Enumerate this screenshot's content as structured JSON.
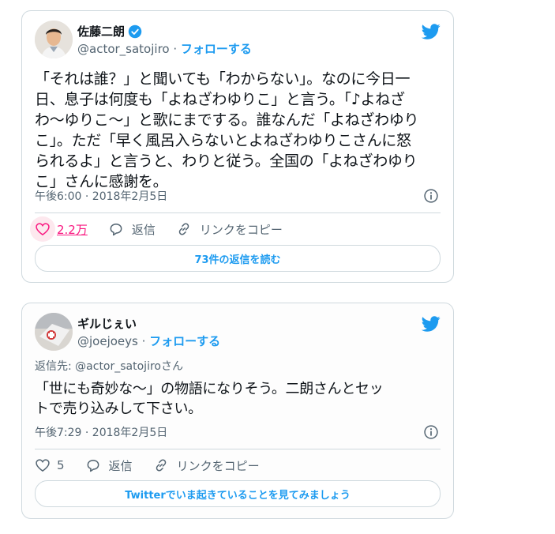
{
  "colors": {
    "accent": "#1d9bf0",
    "like": "#f91880",
    "muted": "#536471",
    "border": "#cfd9de"
  },
  "tweets": [
    {
      "author": {
        "name": "佐藤二朗",
        "handle": "@actor_satojiro",
        "verified": true,
        "follow_label": "フォローする"
      },
      "text": "「それは誰？」と聞いても「わからない」。なのに今日一\n日、息子は何度も「よねざわゆりこ」と言う。「♪よねざ\nわ〜ゆりこ〜」と歌にまでする。誰なんだ「よねざわゆり\nこ」。ただ「早く風呂入らないとよねざわゆりこさんに怒\nられるよ」と言うと、わりと従う。全国の「よねざわゆり\nこ」さんに感謝を。",
      "timestamp": "午後6:00 · 2018年2月5日",
      "likes": "2.2万",
      "reply_label": "返信",
      "copy_link_label": "リンクをコピー",
      "cta": "73件の返信を読む"
    },
    {
      "author": {
        "name": "ギルじぇい",
        "handle": "@joejoeys",
        "verified": false,
        "follow_label": "フォローする"
      },
      "reply_to": "返信先: @actor_satojiroさん",
      "text": "「世にも奇妙な〜」の物語になりそう。二朗さんとセッ\nトで売り込みして下さい。",
      "timestamp": "午後7:29 · 2018年2月5日",
      "likes": "5",
      "reply_label": "返信",
      "copy_link_label": "リンクをコピー",
      "cta": "Twitterでいま起きていることを見てみましょう"
    }
  ]
}
